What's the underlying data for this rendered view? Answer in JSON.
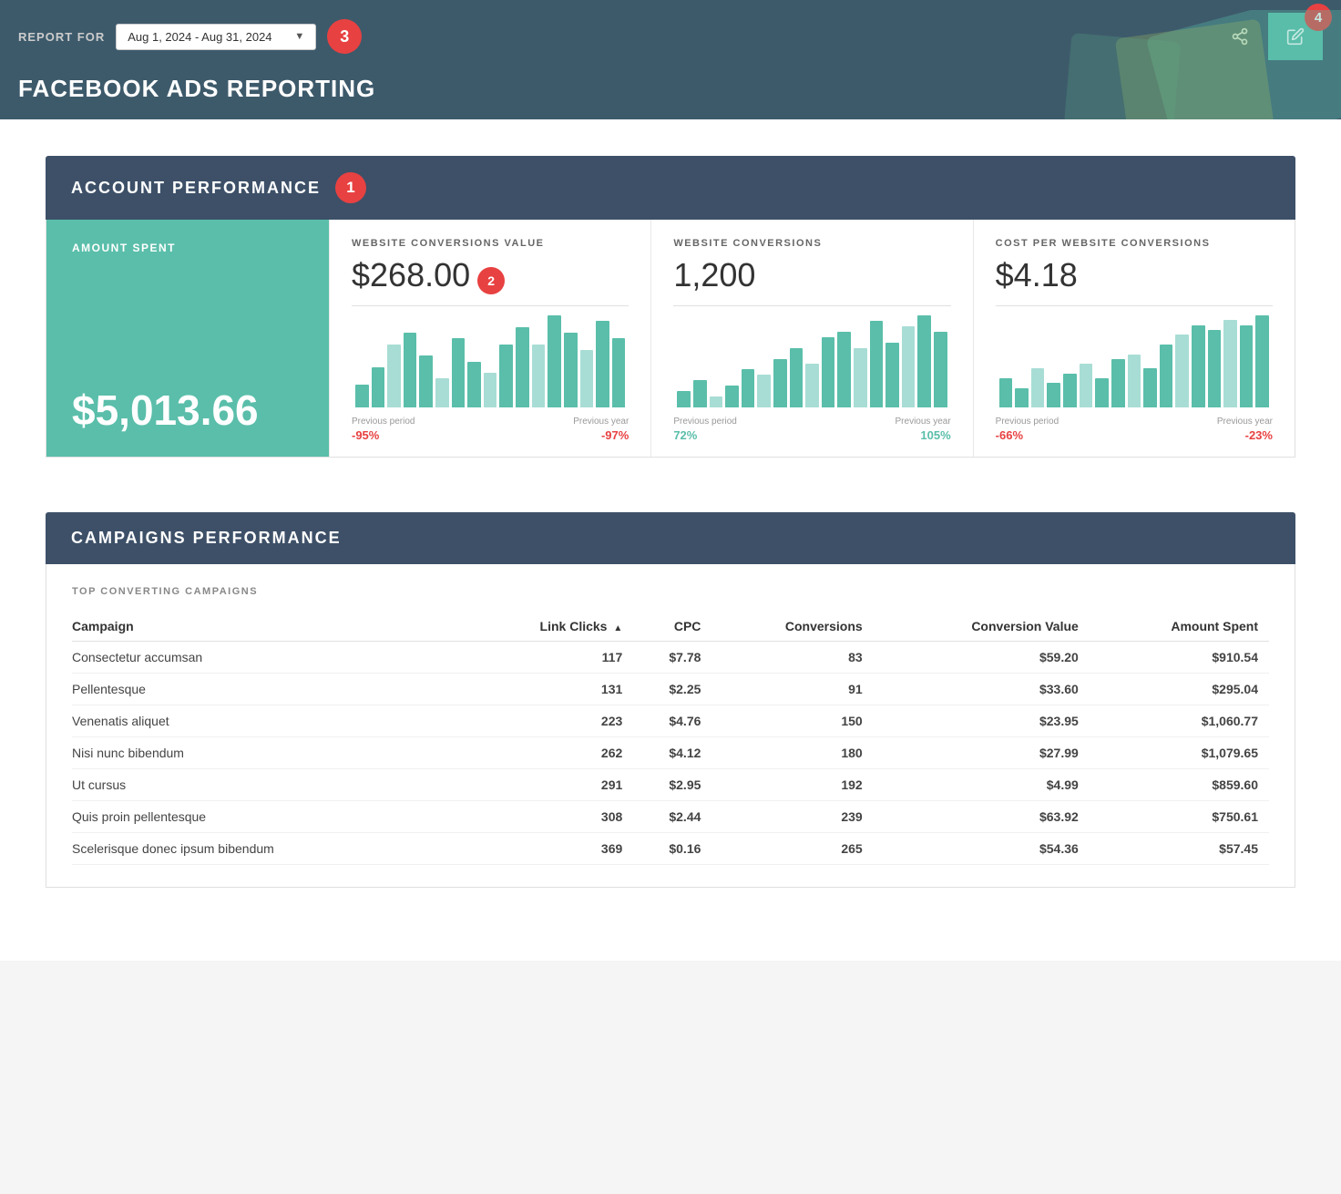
{
  "header": {
    "report_for_label": "REPORT FOR",
    "date_range": "Aug 1, 2024 - Aug 31, 2024",
    "title": "FACEBOOK ADS REPORTING",
    "badge3": "3",
    "badge4": "4"
  },
  "account_performance": {
    "section_title": "ACCOUNT PERFORMANCE",
    "badge": "1",
    "amount_spent": {
      "label": "AMOUNT SPENT",
      "value": "$5,013.66"
    },
    "website_conversions_value": {
      "label": "WEBSITE CONVERSIONS VALUE",
      "value": "$268.00",
      "badge": "2",
      "previous_period_label": "Previous period",
      "previous_period_change": "-95%",
      "previous_year_label": "Previous year",
      "previous_year_change": "-97%",
      "bars": [
        20,
        35,
        55,
        65,
        45,
        25,
        60,
        40,
        30,
        55,
        70,
        55,
        80,
        65,
        50,
        75,
        60
      ]
    },
    "website_conversions": {
      "label": "WEBSITE CONVERSIONS",
      "value": "1,200",
      "previous_period_label": "Previous period",
      "previous_period_change": "72%",
      "previous_year_label": "Previous year",
      "previous_year_change": "105%",
      "bars": [
        15,
        25,
        10,
        20,
        35,
        30,
        45,
        55,
        40,
        65,
        70,
        55,
        80,
        60,
        75,
        85,
        70
      ]
    },
    "cost_per_website_conversions": {
      "label": "COST PER WEBSITE CONVERSIONS",
      "value": "$4.18",
      "previous_period_label": "Previous period",
      "previous_period_change": "-66%",
      "previous_year_label": "Previous year",
      "previous_year_change": "-23%",
      "bars": [
        30,
        20,
        40,
        25,
        35,
        45,
        30,
        50,
        55,
        40,
        65,
        75,
        85,
        80,
        90,
        85,
        95
      ]
    }
  },
  "campaigns_performance": {
    "section_title": "CAMPAIGNS PERFORMANCE",
    "table_subtitle": "TOP CONVERTING CAMPAIGNS",
    "columns": {
      "campaign": "Campaign",
      "link_clicks": "Link Clicks",
      "cpc": "CPC",
      "conversions": "Conversions",
      "conversion_value": "Conversion Value",
      "amount_spent": "Amount Spent"
    },
    "rows": [
      {
        "campaign": "Consectetur accumsan",
        "link_clicks": "117",
        "cpc": "$7.78",
        "conversions": "83",
        "conversion_value": "$59.20",
        "amount_spent": "$910.54"
      },
      {
        "campaign": "Pellentesque",
        "link_clicks": "131",
        "cpc": "$2.25",
        "conversions": "91",
        "conversion_value": "$33.60",
        "amount_spent": "$295.04"
      },
      {
        "campaign": "Venenatis aliquet",
        "link_clicks": "223",
        "cpc": "$4.76",
        "conversions": "150",
        "conversion_value": "$23.95",
        "amount_spent": "$1,060.77"
      },
      {
        "campaign": "Nisi nunc bibendum",
        "link_clicks": "262",
        "cpc": "$4.12",
        "conversions": "180",
        "conversion_value": "$27.99",
        "amount_spent": "$1,079.65"
      },
      {
        "campaign": "Ut cursus",
        "link_clicks": "291",
        "cpc": "$2.95",
        "conversions": "192",
        "conversion_value": "$4.99",
        "amount_spent": "$859.60"
      },
      {
        "campaign": "Quis proin pellentesque",
        "link_clicks": "308",
        "cpc": "$2.44",
        "conversions": "239",
        "conversion_value": "$63.92",
        "amount_spent": "$750.61"
      },
      {
        "campaign": "Scelerisque donec ipsum bibendum",
        "link_clicks": "369",
        "cpc": "$0.16",
        "conversions": "265",
        "conversion_value": "$54.36",
        "amount_spent": "$57.45"
      }
    ]
  }
}
